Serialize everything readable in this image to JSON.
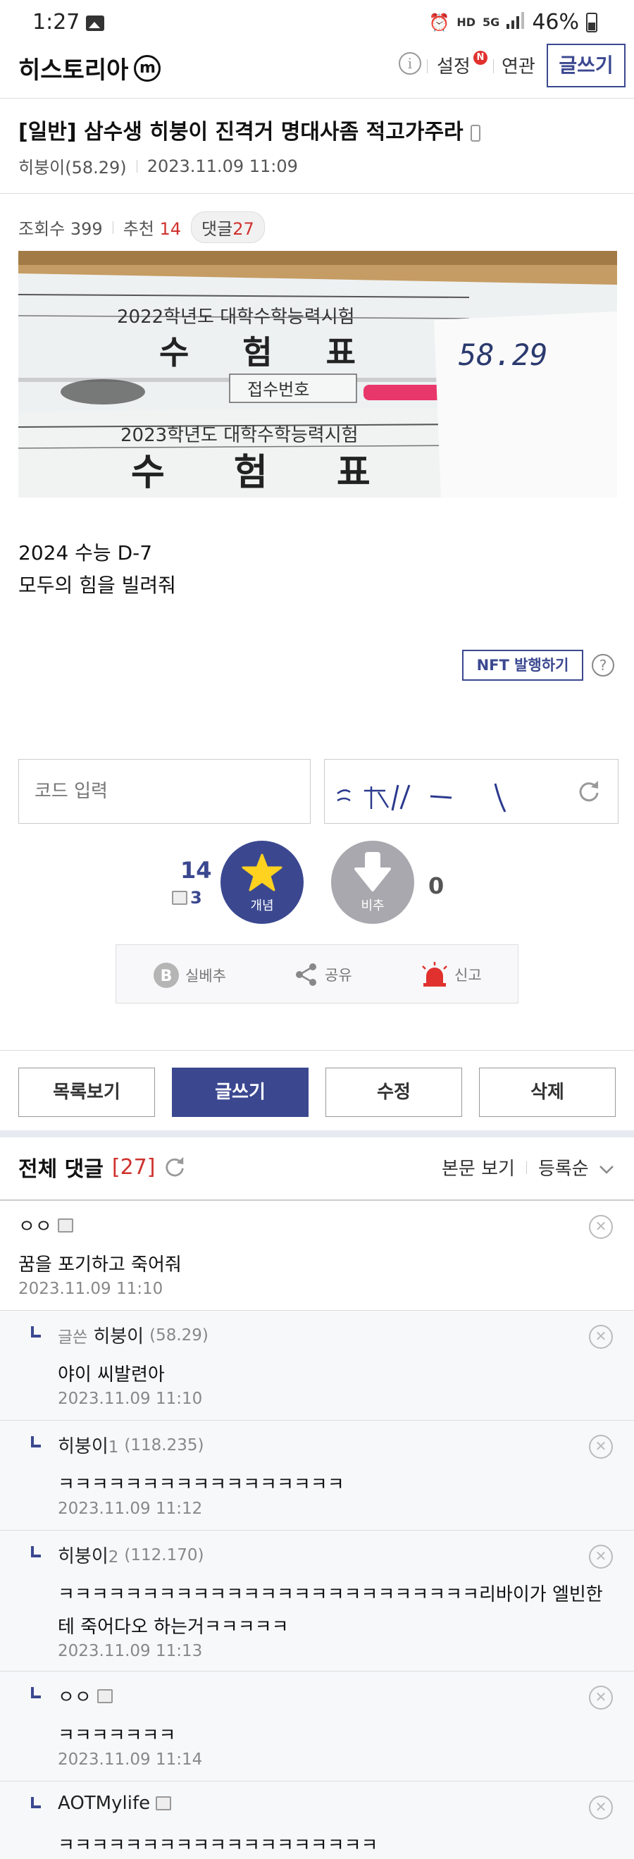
{
  "status_bar": {
    "time": "1:27",
    "battery": "46%",
    "network": "5G",
    "hd": "HD"
  },
  "header": {
    "logo": "히스토리아",
    "logo_mark": "m",
    "settings": "설정",
    "new_badge": "N",
    "related": "연관",
    "write": "글쓰기"
  },
  "post": {
    "title": "[일반] 삼수생 히붕이 진격거 명대사좀 적고가주라",
    "author": "히붕이(58.29)",
    "date": "2023.11.09 11:09",
    "views_label": "조회수 399",
    "recommend_label": "추천",
    "recommend_count": "14",
    "comments_label": "댓글",
    "comments_count": "27",
    "image_texts": {
      "year1": "2022학년도 대학수학능력시험",
      "heading1": "수 험 표",
      "field": "접수번호",
      "year2": "2023학년도 대학수학능력시험",
      "heading2": "수 험 표",
      "note": "58.29"
    },
    "body_lines": [
      "2024 수능 D-7",
      "모두의 힘을 빌려줘"
    ]
  },
  "nft": {
    "label": "NFT 발행하기",
    "help": "?"
  },
  "captcha": {
    "placeholder": "코드 입력"
  },
  "vote": {
    "up_count": "14",
    "fix_count": "3",
    "up_label": "개념",
    "down_label": "비추",
    "down_count": "0"
  },
  "share": {
    "best": "실베추",
    "share": "공유",
    "report": "신고"
  },
  "actions": {
    "list": "목록보기",
    "write": "글쓰기",
    "edit": "수정",
    "delete": "삭제"
  },
  "comments_header": {
    "title": "전체 댓글",
    "count": "[27]",
    "view_body": "본문 보기",
    "sort": "등록순"
  },
  "comments": [
    {
      "author": "ㅇㅇ",
      "ip": "",
      "text": "꿈을 포기하고 죽어줘",
      "date": "2023.11.09 11:10"
    },
    {
      "tag": "글쓴",
      "author": "히붕이",
      "ip": "(58.29)",
      "text": "야이 씨발련아",
      "date": "2023.11.09 11:10"
    },
    {
      "author": "히붕이",
      "num": "1",
      "ip": "(118.235)",
      "text": "ㅋㅋㅋㅋㅋㅋㅋㅋㅋㅋㅋㅋㅋㅋㅋㅋㅋ",
      "date": "2023.11.09 11:12"
    },
    {
      "author": "히붕이",
      "num": "2",
      "ip": "(112.170)",
      "text": "ㅋㅋㅋㅋㅋㅋㅋㅋㅋㅋㅋㅋㅋㅋㅋㅋㅋㅋㅋㅋㅋㅋㅋㅋㅋ리바이가 엘빈한테 죽어다오 하는거ㅋㅋㅋㅋㅋ",
      "date": "2023.11.09 11:13"
    },
    {
      "author": "ㅇㅇ",
      "ip": "",
      "text": "ㅋㅋㅋㅋㅋㅋㅋ",
      "date": "2023.11.09 11:14"
    },
    {
      "author": "AOTMylife",
      "ip": "",
      "text": "ㅋㅋㅋㅋㅋㅋㅋㅋㅋㅋㅋㅋㅋㅋㅋㅋㅋㅋㅋ",
      "date": ""
    }
  ],
  "colors": {
    "accent": "#3b4890",
    "red": "#d0312d",
    "star": "#ffd21f"
  }
}
